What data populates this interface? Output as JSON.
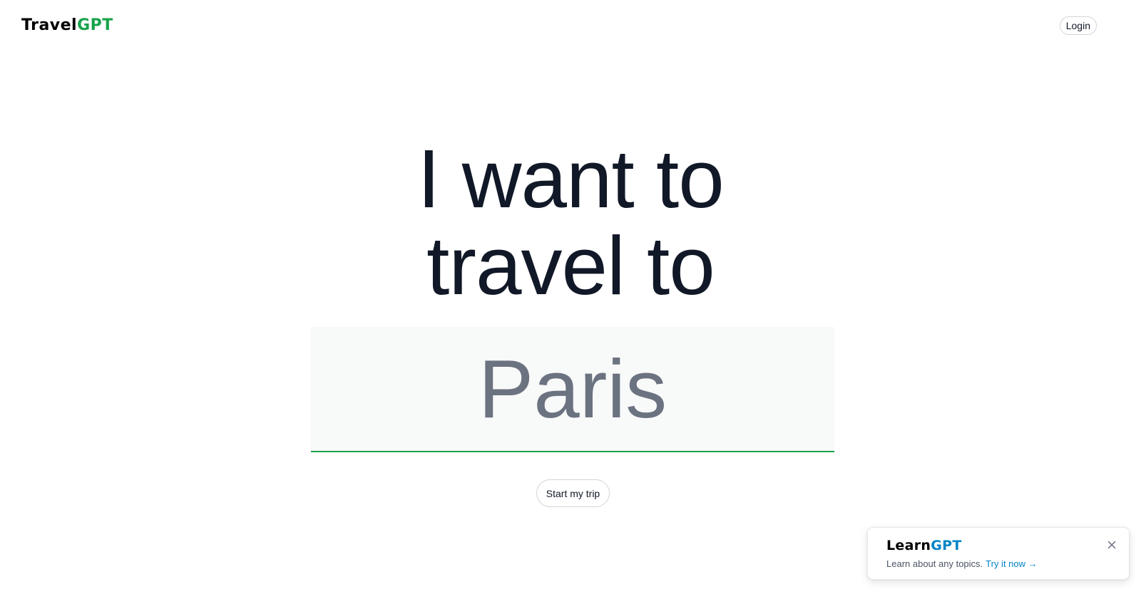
{
  "header": {
    "logo_main": "Travel",
    "logo_accent": "GPT",
    "login_label": "Login"
  },
  "hero": {
    "headline_line1": "I want to",
    "headline_line2": "travel to",
    "destination_value": "Paris",
    "start_label": "Start my trip"
  },
  "promo": {
    "title_main": "Learn",
    "title_accent": "GPT",
    "description": "Learn about any topics.",
    "link_label": "Try it now →",
    "close_icon": "close-icon"
  },
  "colors": {
    "brand_green": "#16a34a",
    "promo_blue": "#0284c7",
    "headline": "#111827",
    "input_text": "#6b7280",
    "input_bg": "#f8f9f9"
  }
}
